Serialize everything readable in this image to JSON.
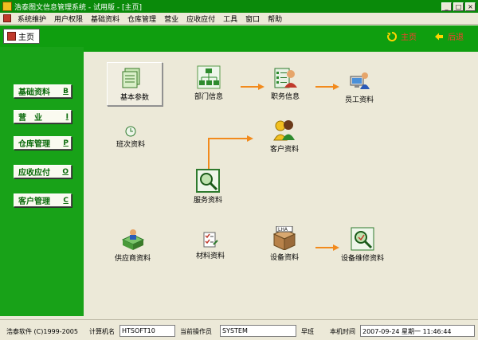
{
  "window": {
    "title": "浩泰图文信息管理系统 - 试用版 - [主页]",
    "min_label": "_",
    "restore_label": "□",
    "close_label": "×"
  },
  "menubar": {
    "items": [
      "系统维护",
      "用户权限",
      "基础资料",
      "仓库管理",
      "营业",
      "应收应付",
      "工具",
      "窗口",
      "帮助"
    ]
  },
  "toolbar": {
    "home_tab": "主页",
    "main_label": "主页",
    "back_label": "后退"
  },
  "sidebar": {
    "items": [
      {
        "label": "基础资料",
        "key": "B"
      },
      {
        "label": "营　业",
        "key": "I"
      },
      {
        "label": "仓库管理",
        "key": "P"
      },
      {
        "label": "应收应付",
        "key": "O"
      },
      {
        "label": "客户管理",
        "key": "C"
      }
    ]
  },
  "workspace": {
    "basic_params": "基本参数",
    "dept_info": "部门信息",
    "job_info": "职务信息",
    "staff_info": "员工资料",
    "shift_info": "班次资料",
    "customer_info": "客户资料",
    "service_info": "服务资料",
    "supplier_info": "供应商资料",
    "material_info": "材料资料",
    "equipment_info": "设备资料",
    "equip_repair_info": "设备维修资料"
  },
  "statusbar": {
    "copyright": "浩泰软件 (C)1999-2005",
    "machine_label": "计算机名",
    "machine_value": "HTSOFT10",
    "operator_label": "当前操作员",
    "operator_value": "SYSTEM",
    "shift_value": "早班",
    "time_label": "本机时间",
    "time_value": "2007-09-24 星期一 11:46:44"
  },
  "colors": {
    "green_band": "#0f9e0f",
    "left_panel": "#18a218",
    "arrow": "#f28a1c"
  }
}
